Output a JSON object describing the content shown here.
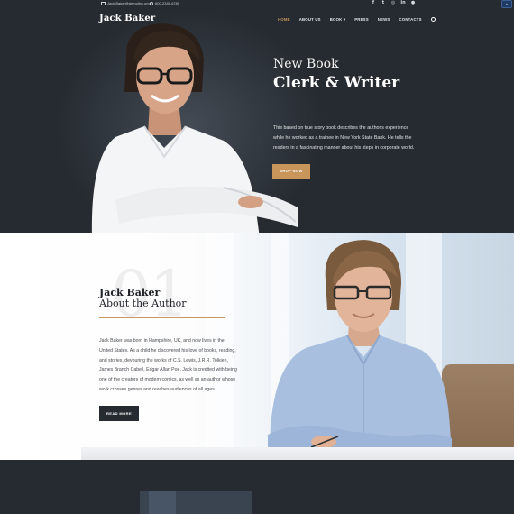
{
  "topbar": {
    "email": "Jack.Baker@demolink.org",
    "phone": "800-2345-6789",
    "socials": [
      "f",
      "t",
      "ig",
      "in",
      "p"
    ]
  },
  "header": {
    "logo": "Jack Baker",
    "nav": [
      "HOME",
      "ABOUT US",
      "BOOK",
      "PRESS",
      "NEWS",
      "CONTACTS"
    ],
    "active_nav": "HOME",
    "book_caret": "▾"
  },
  "hero": {
    "kicker": "New Book",
    "title": "Clerk & Writer",
    "text": "This based on true story book describes the author's experience while he worked as a trainee in New York State Bank. He tells the readers in a fascinating manner about his steps in corporate world.",
    "button": "SHOP NOW"
  },
  "about": {
    "number": "01",
    "name": "Jack Baker",
    "subtitle": "About the Author",
    "text": "Jack Baker was born in Hampshire, UK, and now lives in the United States. As a child he discovered his love of books, reading, and stories, devouring the works of C.S. Lewis, J.R.R. Tolkien, James Branch Cabell, Edgar Allan Poe. Jack is credited with being one of the creators of modern comics, as well as an author whose work crosses genres and reaches audiences of all ages.",
    "button": "READ MORE"
  },
  "colors": {
    "accent": "#c8955b",
    "dark": "#262b31"
  }
}
